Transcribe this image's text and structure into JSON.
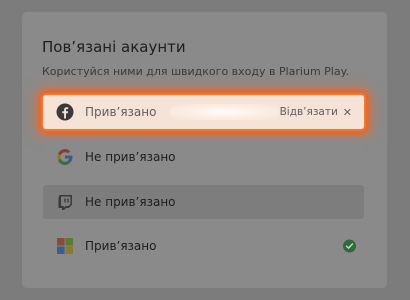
{
  "panel": {
    "title": "Пов’язані акаунти",
    "subtitle": "Користуйся ними для швидкого входу в Plarium Play."
  },
  "accounts": [
    {
      "provider": "facebook",
      "icon": "facebook-icon",
      "status": "Прив’язано",
      "action_label": "Відв’язати",
      "action_icon": "close-icon",
      "highlighted": true
    },
    {
      "provider": "google",
      "icon": "google-icon",
      "status": "Не прив’язано"
    },
    {
      "provider": "twitch",
      "icon": "twitch-icon",
      "status": "Не прив’язано"
    },
    {
      "provider": "microsoft",
      "icon": "microsoft-icon",
      "status": "Прив’язано",
      "linked_icon": "check-circle-icon"
    }
  ],
  "colors": {
    "overlay": "#7c7c7c",
    "panel": "#8a8a8a",
    "highlight_glow": "#ff5c14",
    "linked_check": "#2f6b3a",
    "facebook_blue": "#1b1b1b"
  }
}
